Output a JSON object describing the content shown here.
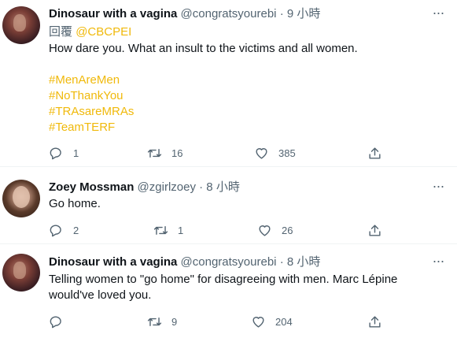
{
  "tweets": [
    {
      "author": "Dinosaur with a vagina",
      "handle": "@congratsyourebi",
      "time": "· 9 小時",
      "reply_label": "回覆",
      "reply_handle": "@CBCPEI",
      "text": "How dare you. What an insult to the victims and all women.",
      "hashtags": [
        "#MenAreMen",
        "#NoThankYou",
        "#TRAsareMRAs",
        "#TeamTERF"
      ],
      "replies": "1",
      "retweets": "16",
      "likes": "385"
    },
    {
      "author": "Zoey Mossman",
      "handle": "@zgirlzoey",
      "time": "· 8 小時",
      "text": "Go home.",
      "replies": "2",
      "retweets": "1",
      "likes": "26"
    },
    {
      "author": "Dinosaur with a vagina",
      "handle": "@congratsyourebi",
      "time": "· 8 小時",
      "text_line1": "Telling women to \"go home\" for disagreeing with men. Marc Lépine",
      "text_line2": "would've loved you.",
      "replies": "",
      "retweets": "9",
      "likes": "204"
    }
  ],
  "icons": {
    "reply": "speech-bubble-icon",
    "retweet": "retweet-arrows-icon",
    "like": "heart-icon",
    "share": "share-upload-icon",
    "more": "more-dots-icon"
  },
  "colors": {
    "accent": "#f0b90b",
    "secondary_text": "#536471",
    "primary_text": "#0f1419"
  }
}
